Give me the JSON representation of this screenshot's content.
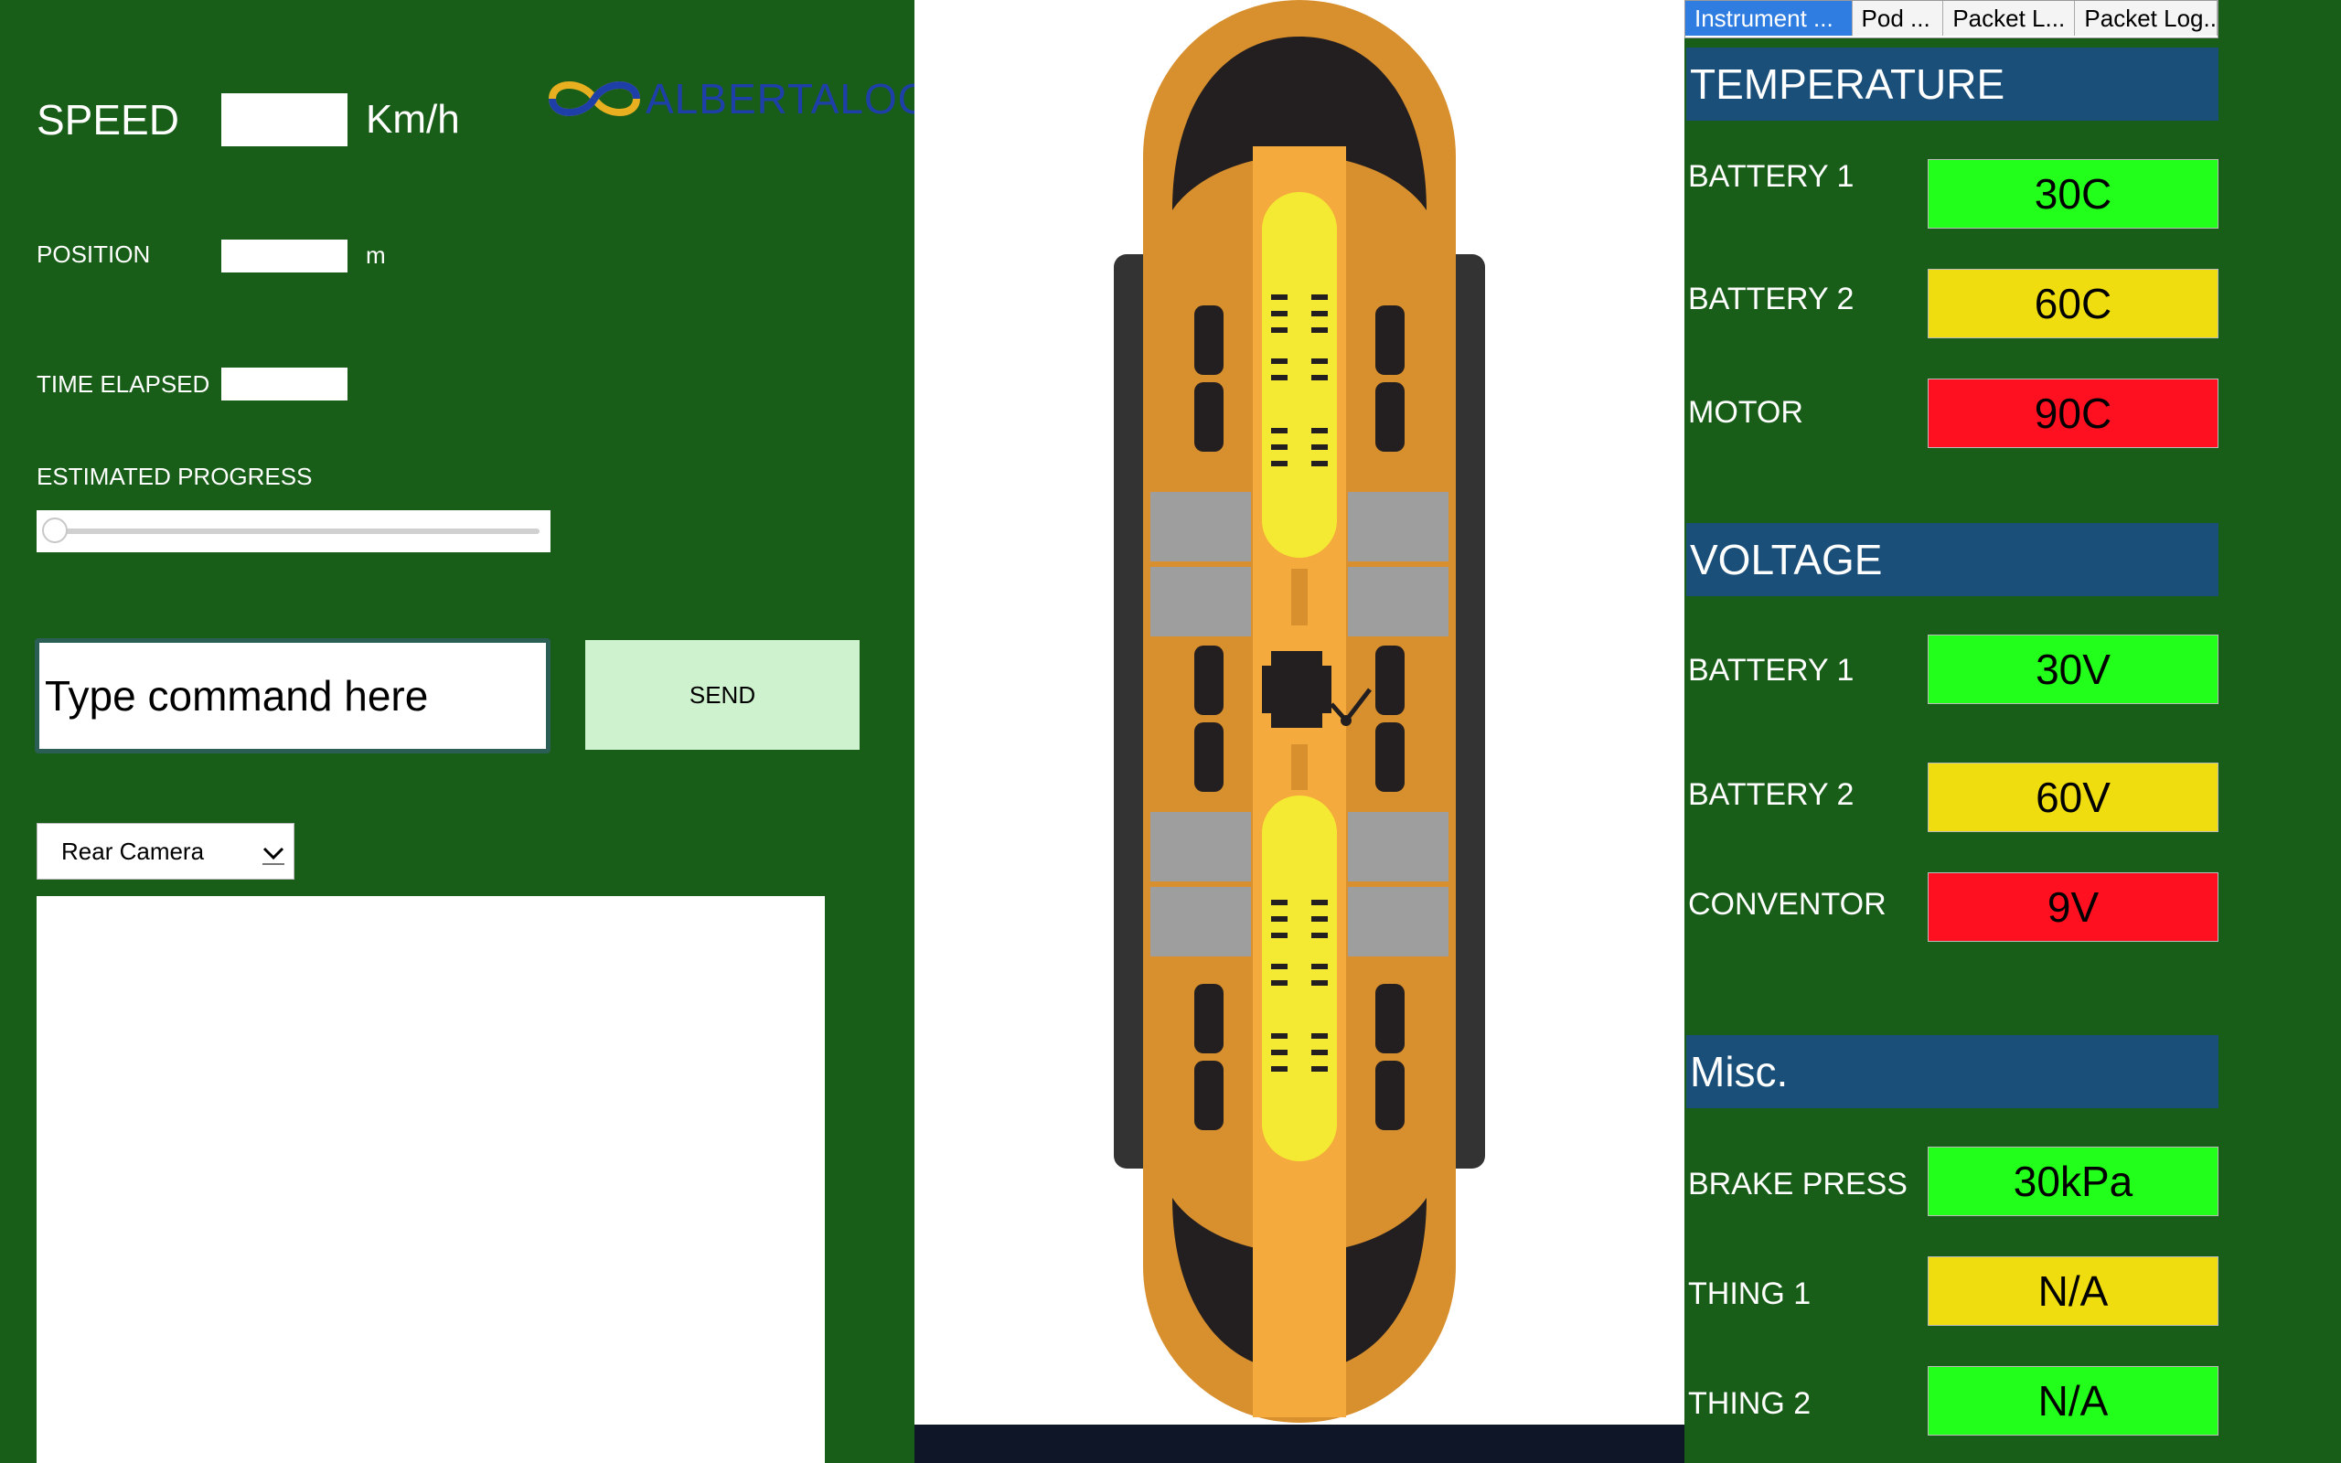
{
  "left": {
    "speed": {
      "label": "SPEED",
      "value": "",
      "unit": "Km/h"
    },
    "position": {
      "label": "POSITION",
      "value": "",
      "unit": "m"
    },
    "time_elapsed": {
      "label": "TIME ELAPSED",
      "value": ""
    },
    "estimated_progress": {
      "label": "ESTIMATED PROGRESS",
      "value_percent": 0
    },
    "command": {
      "placeholder": "Type command here",
      "value": ""
    },
    "send_label": "SEND",
    "camera_select": {
      "selected": "Rear Camera"
    },
    "logo_text": "ALBERTALOOP"
  },
  "tabs": [
    "Instrument ...",
    "Pod ...",
    "Packet L...",
    "Packet Log..."
  ],
  "active_tab": 0,
  "sections": {
    "temperature": {
      "title": "TEMPERATURE",
      "rows": [
        {
          "label": "BATTERY 1",
          "value": "30C",
          "status": "green"
        },
        {
          "label": "BATTERY 2",
          "value": "60C",
          "status": "yellow"
        },
        {
          "label": "MOTOR",
          "value": "90C",
          "status": "red"
        }
      ]
    },
    "voltage": {
      "title": "VOLTAGE",
      "rows": [
        {
          "label": "BATTERY 1",
          "value": "30V",
          "status": "green"
        },
        {
          "label": "BATTERY 2",
          "value": "60V",
          "status": "yellow"
        },
        {
          "label": "CONVENTOR",
          "value": "9V",
          "status": "red"
        }
      ]
    },
    "misc": {
      "title": "Misc.",
      "rows": [
        {
          "label": "BRAKE PRESS",
          "value": "30kPa",
          "status": "green"
        },
        {
          "label": "THING 1",
          "value": "N/A",
          "status": "yellow"
        },
        {
          "label": "THING 2",
          "value": "N/A",
          "status": "green"
        }
      ]
    }
  },
  "colors": {
    "panel_green": "#185d18",
    "section_blue": "#1a4f7a",
    "status_green": "#22ff1a",
    "status_yellow": "#f0dd10",
    "status_red": "#ff1020",
    "send_button": "#cdf2cd",
    "pod_orange": "#d8902e",
    "pod_yellow": "#f5ea33"
  },
  "icons": [
    "albertaloop-logo-icon",
    "chevron-down-icon",
    "pod-illustration"
  ]
}
